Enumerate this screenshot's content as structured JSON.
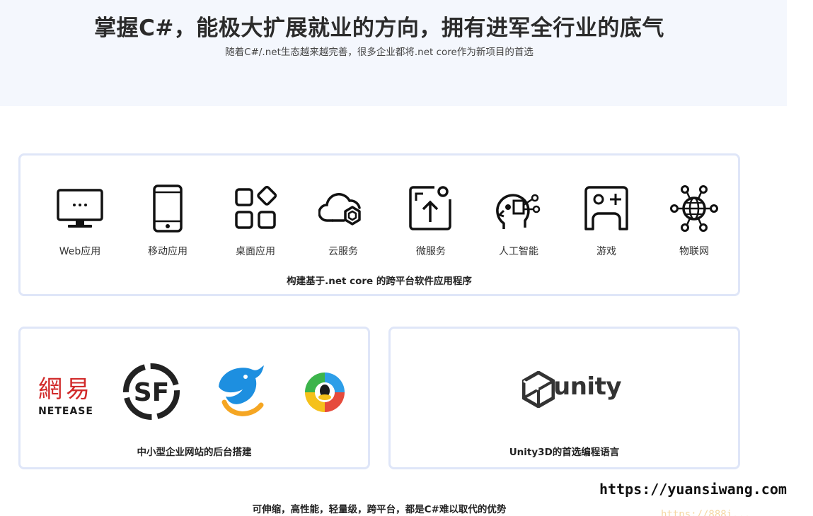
{
  "hero": {
    "title": "掌握C#，能极大扩展就业的方向，拥有进军全行业的底气",
    "subtitle": "随着C#/.net生态越来越完善，很多企业都将.net core作为新项目的首选"
  },
  "platforms": {
    "items": [
      {
        "label": "Web应用",
        "icon": "monitor-icon"
      },
      {
        "label": "移动应用",
        "icon": "phone-icon"
      },
      {
        "label": "桌面应用",
        "icon": "desktop-app-icon"
      },
      {
        "label": "云服务",
        "icon": "cloud-icon"
      },
      {
        "label": "微服务",
        "icon": "microservice-icon"
      },
      {
        "label": "人工智能",
        "icon": "ai-head-icon"
      },
      {
        "label": "游戏",
        "icon": "game-icon"
      },
      {
        "label": "物联网",
        "icon": "iot-icon"
      }
    ],
    "caption": "构建基于.net core 的跨平台软件应用程序"
  },
  "enterprise": {
    "caption": "中小型企业网站的后台搭建",
    "logos": {
      "netease_cn": "網易",
      "netease_en": "NETEASE",
      "sf_text": "SF"
    }
  },
  "unity": {
    "logo_text": "unity",
    "caption": "Unity3D的首选编程语言"
  },
  "tagline": "可伸缩，高性能，轻量级，跨平台，都是C#难以取代的优势",
  "watermark": "https://yuansiwang.com",
  "watermark_faint": "https://888i..."
}
